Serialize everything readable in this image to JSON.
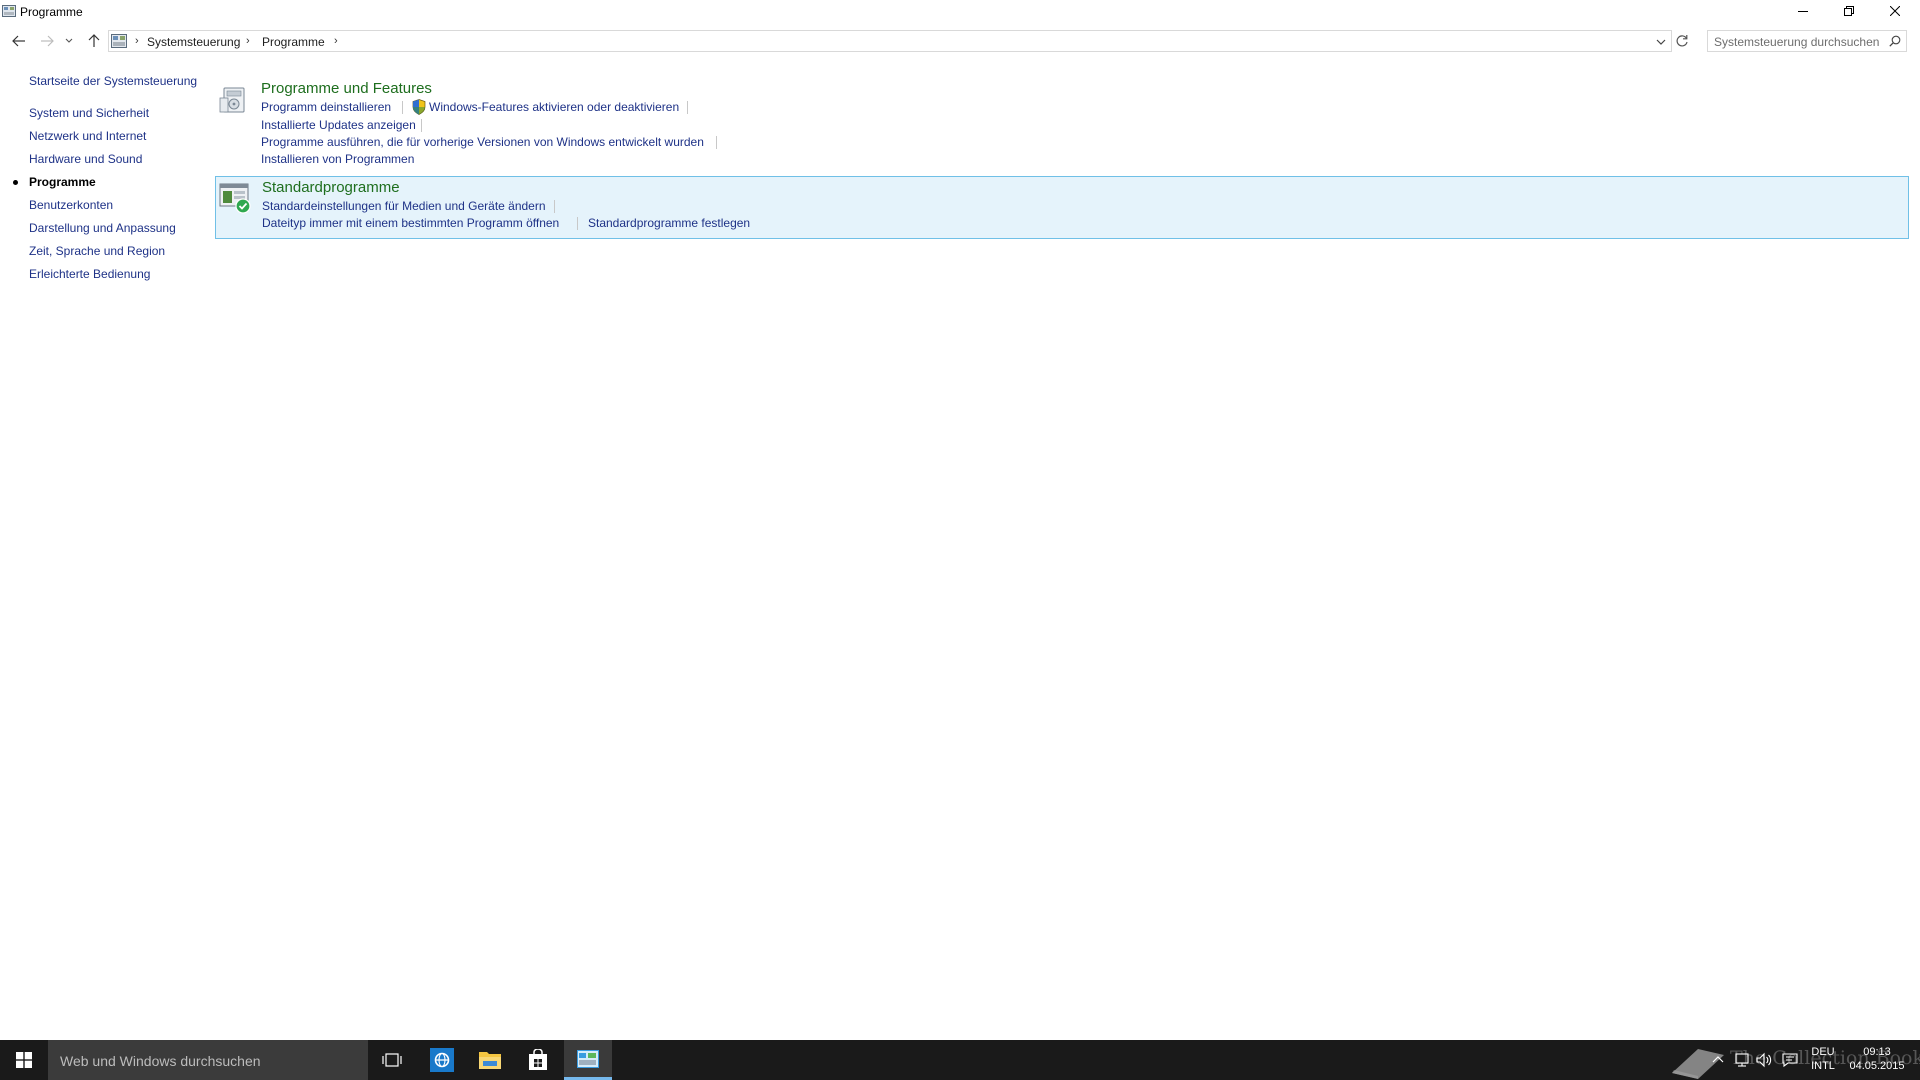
{
  "window": {
    "title": "Programme"
  },
  "address": {
    "crumbs": [
      "Systemsteuerung",
      "Programme"
    ]
  },
  "search": {
    "placeholder": "Systemsteuerung durchsuchen"
  },
  "sidebar": {
    "home_label": "Startseite der Systemsteuerung",
    "items": [
      {
        "label": "System und Sicherheit",
        "active": false
      },
      {
        "label": "Netzwerk und Internet",
        "active": false
      },
      {
        "label": "Hardware und Sound",
        "active": false
      },
      {
        "label": "Programme",
        "active": true
      },
      {
        "label": "Benutzerkonten",
        "active": false
      },
      {
        "label": "Darstellung und Anpassung",
        "active": false
      },
      {
        "label": "Zeit, Sprache und Region",
        "active": false
      },
      {
        "label": "Erleichterte Bedienung",
        "active": false
      }
    ]
  },
  "categories": {
    "programs": {
      "title": "Programme und Features",
      "links": [
        "Programm deinstallieren",
        "Windows-Features aktivieren oder deaktivieren",
        "Installierte Updates anzeigen",
        "Programme ausführen, die für vorherige Versionen von Windows entwickelt wurden",
        "Installieren von Programmen"
      ]
    },
    "defaults": {
      "title": "Standardprogramme",
      "links": [
        "Standardeinstellungen für Medien und Geräte ändern",
        "Dateityp immer mit einem bestimmten Programm öffnen",
        "Standardprogramme festlegen"
      ]
    }
  },
  "taskbar": {
    "search_placeholder": "Web und Windows durchsuchen",
    "language": "DEU",
    "keyboard": "INTL",
    "time": "09:13",
    "date": "04.05.2015",
    "watermark": "The Collection Book"
  },
  "colors": {
    "link": "#1e3287",
    "category_title": "#1e6e1e",
    "highlight_bg": "#e5f3fb",
    "highlight_border": "#70c0e7",
    "taskbar": "#1a1a1a"
  }
}
